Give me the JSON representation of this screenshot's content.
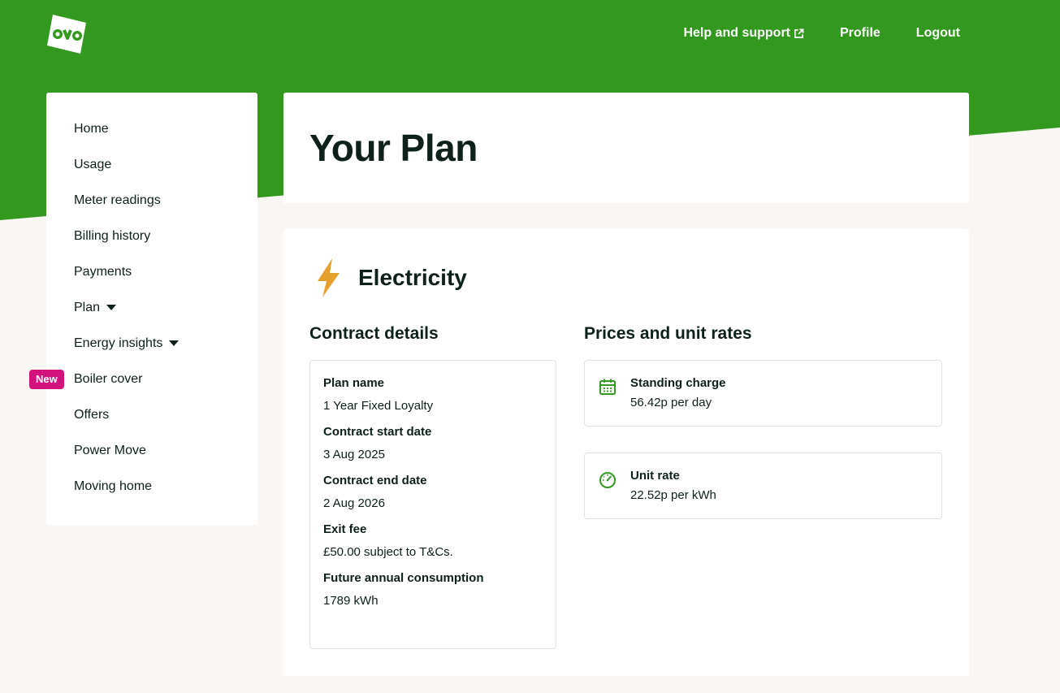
{
  "colors": {
    "brand_green": "#32991e",
    "text_dark": "#0d2019",
    "badge_pink": "#d4127e",
    "icon_orange": "#e5a02b",
    "page_bg": "#f9f6f3"
  },
  "header": {
    "logo_text": "ovo",
    "nav": [
      {
        "label": "Help and support",
        "icon": "external-link-icon"
      },
      {
        "label": "Profile"
      },
      {
        "label": "Logout"
      }
    ]
  },
  "sidebar": {
    "items": [
      {
        "label": "Home"
      },
      {
        "label": "Usage"
      },
      {
        "label": "Meter readings"
      },
      {
        "label": "Billing history"
      },
      {
        "label": "Payments"
      },
      {
        "label": "Plan",
        "dropdown": true
      },
      {
        "label": "Energy insights",
        "dropdown": true
      },
      {
        "label": "Boiler cover",
        "badge": "New"
      },
      {
        "label": "Offers"
      },
      {
        "label": "Power Move"
      },
      {
        "label": "Moving home"
      }
    ]
  },
  "page": {
    "title": "Your Plan"
  },
  "electricity": {
    "heading": "Electricity",
    "icon": "lightning-bolt-icon",
    "contract": {
      "title": "Contract details",
      "items": [
        {
          "label": "Plan name",
          "value": "1 Year Fixed Loyalty"
        },
        {
          "label": "Contract start date",
          "value": "3 Aug 2025"
        },
        {
          "label": "Contract end date",
          "value": "2 Aug 2026"
        },
        {
          "label": "Exit fee",
          "value": "£50.00 subject to T&Cs."
        },
        {
          "label": "Future annual consumption",
          "value": "1789 kWh"
        }
      ]
    },
    "prices": {
      "title": "Prices and unit rates",
      "items": [
        {
          "label": "Standing charge",
          "value": "56.42p per day",
          "icon": "calendar-icon"
        },
        {
          "label": "Unit rate",
          "value": "22.52p per kWh",
          "icon": "speedometer-icon"
        }
      ]
    }
  }
}
